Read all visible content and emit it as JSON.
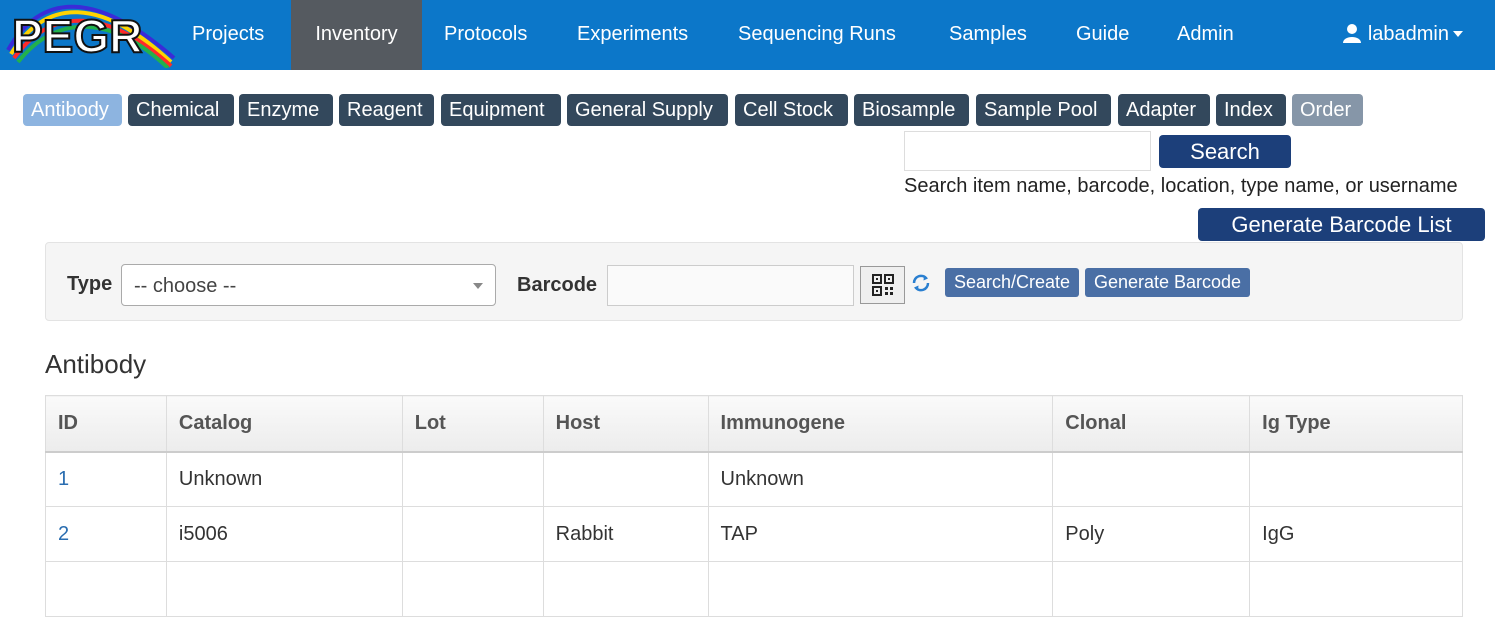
{
  "nav": {
    "logo_text": "PEGR",
    "items": [
      {
        "label": "Projects",
        "active": false
      },
      {
        "label": "Inventory",
        "active": true
      },
      {
        "label": "Protocols",
        "active": false
      },
      {
        "label": "Experiments",
        "active": false
      },
      {
        "label": "Sequencing Runs",
        "active": false
      },
      {
        "label": "Samples",
        "active": false
      },
      {
        "label": "Guide",
        "active": false
      },
      {
        "label": "Admin",
        "active": false
      }
    ],
    "user": "labadmin"
  },
  "categories": [
    {
      "label": "Antibody",
      "active": true
    },
    {
      "label": "Chemical"
    },
    {
      "label": "Enzyme"
    },
    {
      "label": "Reagent"
    },
    {
      "label": "Equipment"
    },
    {
      "label": "General Supply"
    },
    {
      "label": "Cell Stock"
    },
    {
      "label": "Biosample"
    },
    {
      "label": "Sample Pool"
    },
    {
      "label": "Adapter"
    },
    {
      "label": "Index"
    },
    {
      "label": "Order"
    }
  ],
  "search": {
    "value": "",
    "button_label": "Search",
    "hint": "Search item name, barcode, location, type name, or username",
    "generate_list_label": "Generate Barcode List"
  },
  "filter": {
    "type_label": "Type",
    "type_selected": "-- choose --",
    "barcode_label": "Barcode",
    "barcode_value": "",
    "search_create_label": "Search/Create",
    "generate_barcode_label": "Generate Barcode"
  },
  "section_title": "Antibody",
  "table": {
    "columns": [
      "ID",
      "Catalog",
      "Lot",
      "Host",
      "Immunogene",
      "Clonal",
      "Ig Type"
    ],
    "rows": [
      [
        "1",
        "Unknown",
        "",
        "",
        "Unknown",
        "",
        ""
      ],
      [
        "2",
        "i5006",
        "",
        "Rabbit",
        "TAP",
        "Poly",
        "IgG"
      ],
      [
        "",
        "",
        "",
        "",
        "",
        "",
        ""
      ]
    ]
  },
  "colors": {
    "navbar": "#0c77c9",
    "nav_active": "#555a60",
    "category_button": "#33485c",
    "category_active": "#8db4e0",
    "primary_button": "#1c3f7a",
    "small_button": "#4a6fa5",
    "link": "#2a6db0"
  }
}
